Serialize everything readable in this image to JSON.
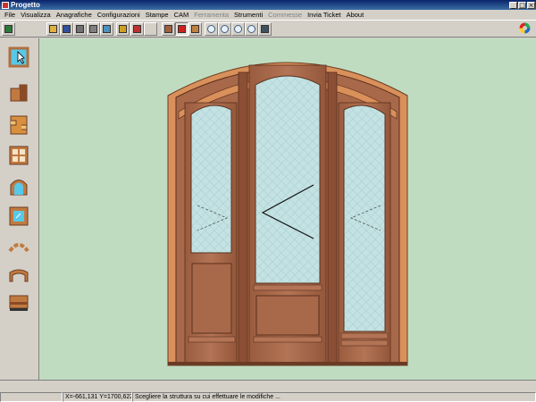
{
  "window": {
    "title": "Progetto",
    "buttons": [
      "_",
      "□",
      "×"
    ]
  },
  "menu": [
    {
      "label": "File",
      "enabled": true
    },
    {
      "label": "Visualizza",
      "enabled": true
    },
    {
      "label": "Anagrafiche",
      "enabled": true
    },
    {
      "label": "Configurazioni",
      "enabled": true
    },
    {
      "label": "Stampe",
      "enabled": true
    },
    {
      "label": "CAM",
      "enabled": true
    },
    {
      "label": "Ferramenta",
      "enabled": false
    },
    {
      "label": "Strumenti",
      "enabled": true
    },
    {
      "label": "Commesse",
      "enabled": false
    },
    {
      "label": "Invia Ticket",
      "enabled": true
    },
    {
      "label": "About",
      "enabled": true
    }
  ],
  "toolbar": {
    "buttons": [
      {
        "icon": "layout-icon"
      },
      {
        "icon": "open-folder-icon"
      },
      {
        "icon": "save-icon"
      },
      {
        "icon": "delete-icon"
      },
      {
        "icon": "print-icon"
      },
      {
        "icon": "preview-icon"
      },
      {
        "icon": "wizard-icon"
      },
      {
        "icon": "cut-icon"
      },
      {
        "icon": "blank-icon"
      },
      {
        "icon": "section-view-icon"
      },
      {
        "icon": "frame-red-icon",
        "pressed": true
      },
      {
        "icon": "measure-icon"
      },
      {
        "icon": "zoom-window-icon"
      },
      {
        "icon": "zoom-in-icon"
      },
      {
        "icon": "zoom-out-icon"
      },
      {
        "icon": "refresh-icon"
      },
      {
        "icon": "camera-icon"
      }
    ]
  },
  "palette": [
    {
      "icon": "select-pointer-icon"
    },
    {
      "icon": "profile-block-icon"
    },
    {
      "icon": "panel-insert-icon"
    },
    {
      "icon": "window-frame-icon"
    },
    {
      "icon": "arch-frame-icon"
    },
    {
      "icon": "glass-pane-icon"
    },
    {
      "icon": "arc-segment-icon"
    },
    {
      "icon": "curved-rail-icon"
    },
    {
      "icon": "sill-icon"
    }
  ],
  "colors": {
    "canvas": "#c0dcc0",
    "frame_outer": "#d9905a",
    "wood": "#a8684a",
    "wood_dark": "#6b3b24",
    "glass": "#bfe0e0"
  },
  "status": {
    "left": "",
    "coords": "X=-661,131 Y=1700,622",
    "message": "Scegliere la struttura su cui effettuare le modifiche ..."
  }
}
